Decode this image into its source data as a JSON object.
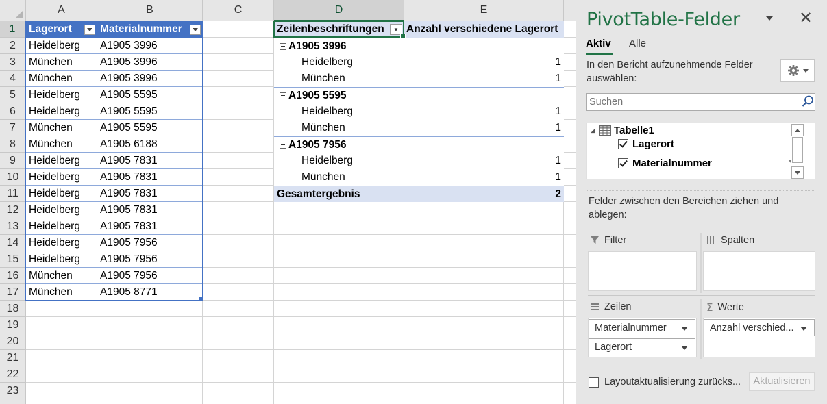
{
  "sheet": {
    "columns": [
      "A",
      "B",
      "C",
      "D",
      "E"
    ],
    "rows": [
      "1",
      "2",
      "3",
      "4",
      "5",
      "6",
      "7",
      "8",
      "9",
      "10",
      "11",
      "12",
      "13",
      "14",
      "15",
      "16",
      "17",
      "18",
      "19",
      "20",
      "21",
      "22",
      "23"
    ],
    "table": {
      "headers": [
        "Lagerort",
        "Materialnummer"
      ],
      "rows": [
        [
          "Heidelberg",
          "A1905 3996"
        ],
        [
          "München",
          "A1905 3996"
        ],
        [
          "München",
          "A1905 3996"
        ],
        [
          "Heidelberg",
          "A1905 5595"
        ],
        [
          "Heidelberg",
          "A1905 5595"
        ],
        [
          "München",
          "A1905 5595"
        ],
        [
          "München",
          "A1905 6188"
        ],
        [
          "Heidelberg",
          "A1905 7831"
        ],
        [
          "Heidelberg",
          "A1905 7831"
        ],
        [
          "Heidelberg",
          "A1905 7831"
        ],
        [
          "Heidelberg",
          "A1905 7831"
        ],
        [
          "Heidelberg",
          "A1905 7831"
        ],
        [
          "Heidelberg",
          "A1905 7956"
        ],
        [
          "Heidelberg",
          "A1905 7956"
        ],
        [
          "München",
          "A1905 7956"
        ],
        [
          "München",
          "A1905 8771"
        ]
      ]
    },
    "pivot": {
      "row_header": "Zeilenbeschriftungen",
      "value_header": "Anzahl verschiedene Lagerort",
      "groups": [
        {
          "label": "A1905 3996",
          "items": [
            {
              "label": "Heidelberg",
              "value": "1"
            },
            {
              "label": "München",
              "value": "1"
            }
          ]
        },
        {
          "label": "A1905 5595",
          "items": [
            {
              "label": "Heidelberg",
              "value": "1"
            },
            {
              "label": "München",
              "value": "1"
            }
          ]
        },
        {
          "label": "A1905 7956",
          "items": [
            {
              "label": "Heidelberg",
              "value": "1"
            },
            {
              "label": "München",
              "value": "1"
            }
          ]
        }
      ],
      "total_label": "Gesamtergebnis",
      "total_value": "2"
    }
  },
  "pane": {
    "title": "PivotTable-Felder",
    "tabs": [
      "Aktiv",
      "Alle"
    ],
    "instruction": "In den Bericht aufzunehmende Felder auswählen:",
    "search_placeholder": "Suchen",
    "table_name": "Tabelle1",
    "fields": [
      {
        "label": "Lagerort",
        "checked": true
      },
      {
        "label": "Materialnummer",
        "checked": true
      }
    ],
    "drag_instruction": "Felder zwischen den Bereichen ziehen und ablegen:",
    "areas": {
      "filter_label": "Filter",
      "columns_label": "Spalten",
      "rows_label": "Zeilen",
      "values_label": "Werte",
      "rows_fields": [
        "Materialnummer",
        "Lagerort"
      ],
      "values_fields": [
        "Anzahl verschied..."
      ]
    },
    "defer_label": "Layoutaktualisierung zurücks...",
    "update_label": "Aktualisieren"
  },
  "colors": {
    "accent": "#217346",
    "table_header": "#4472c4",
    "pivot_header": "#d9e1f2"
  }
}
